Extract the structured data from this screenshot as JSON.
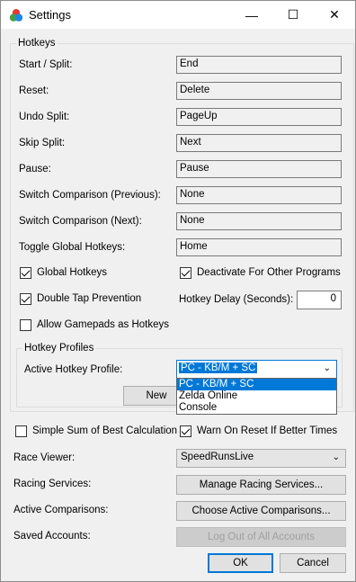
{
  "window": {
    "title": "Settings",
    "minimize": "—",
    "maximize": "☐",
    "close": "✕"
  },
  "hotkeys": {
    "group_title": "Hotkeys",
    "rows": [
      {
        "label": "Start / Split:",
        "value": "End"
      },
      {
        "label": "Reset:",
        "value": "Delete"
      },
      {
        "label": "Undo Split:",
        "value": "PageUp"
      },
      {
        "label": "Skip Split:",
        "value": "Next"
      },
      {
        "label": "Pause:",
        "value": "Pause"
      },
      {
        "label": "Switch Comparison (Previous):",
        "value": "None"
      },
      {
        "label": "Switch Comparison (Next):",
        "value": "None"
      },
      {
        "label": "Toggle Global Hotkeys:",
        "value": "Home"
      }
    ],
    "global_hotkeys": {
      "label": "Global Hotkeys",
      "checked": true
    },
    "deactivate_other": {
      "label": "Deactivate For Other Programs",
      "checked": true
    },
    "double_tap": {
      "label": "Double Tap Prevention",
      "checked": true
    },
    "hotkey_delay": {
      "label": "Hotkey Delay (Seconds):",
      "value": "0"
    },
    "allow_gamepads": {
      "label": "Allow Gamepads as Hotkeys",
      "checked": false
    }
  },
  "profiles": {
    "group_title": "Hotkey Profiles",
    "active_label": "Active Hotkey Profile:",
    "selected": "PC - KB/M + SC",
    "options": [
      "PC - KB/M + SC",
      "Zelda Online",
      "Console"
    ],
    "new_button": "New"
  },
  "general": {
    "simple_sob": {
      "label": "Simple Sum of Best Calculation",
      "checked": false
    },
    "warn_reset": {
      "label": "Warn On Reset If Better Times",
      "checked": true
    },
    "race_viewer": {
      "label": "Race Viewer:",
      "value": "SpeedRunsLive"
    },
    "racing_services": {
      "label": "Racing Services:",
      "button": "Manage Racing Services..."
    },
    "active_comparisons": {
      "label": "Active Comparisons:",
      "button": "Choose Active Comparisons..."
    },
    "saved_accounts": {
      "label": "Saved Accounts:",
      "button": "Log Out of All Accounts"
    }
  },
  "footer": {
    "ok": "OK",
    "cancel": "Cancel"
  },
  "colors": {
    "accent": "#0078d7",
    "window_bg": "#f0f0f0",
    "field_border": "#7a7a7a"
  }
}
